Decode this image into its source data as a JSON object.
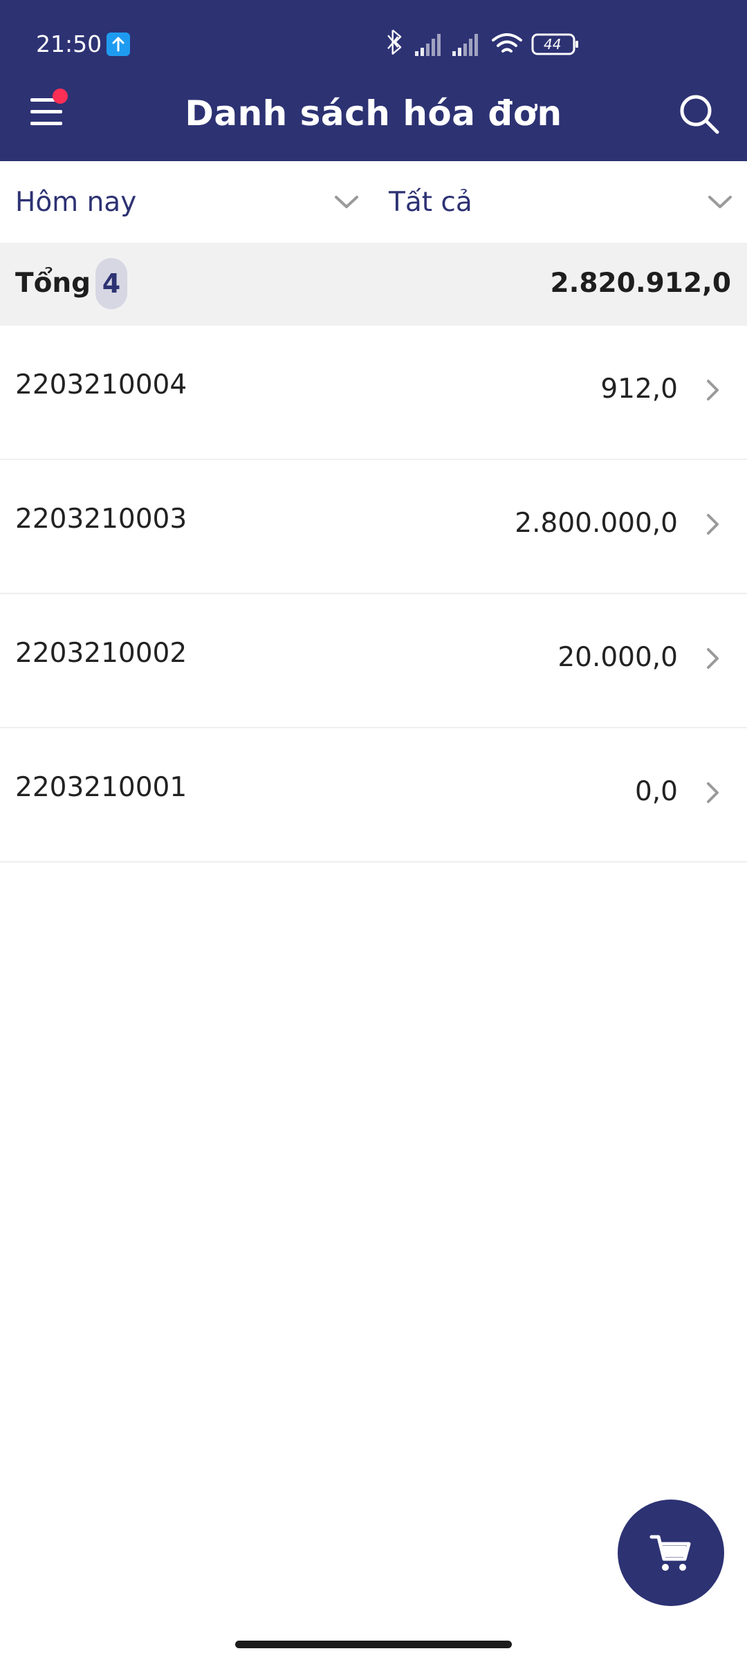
{
  "status_bar": {
    "time": "21:50",
    "upload_icon": "arrow-up-icon",
    "battery_level": "44",
    "icons": [
      "bluetooth-icon",
      "signal-icon",
      "signal-icon",
      "wifi-icon",
      "battery-icon"
    ]
  },
  "header": {
    "title": "Danh sách hóa đơn",
    "menu_icon": "hamburger-menu-icon",
    "search_icon": "search-icon"
  },
  "filters": {
    "date_filter": "Hôm nay",
    "status_filter": "Tất cả"
  },
  "summary": {
    "label": "Tổng",
    "count": "4",
    "total": "2.820.912,0"
  },
  "invoices": [
    {
      "id": "2203210004",
      "amount": "912,0"
    },
    {
      "id": "2203210003",
      "amount": "2.800.000,0"
    },
    {
      "id": "2203210002",
      "amount": "20.000,0"
    },
    {
      "id": "2203210001",
      "amount": "0,0"
    }
  ],
  "fab": {
    "icon": "cart-icon"
  },
  "colors": {
    "primary": "#2d3273",
    "notification_dot": "#ff2e55",
    "summary_background": "#f1f1f1"
  }
}
